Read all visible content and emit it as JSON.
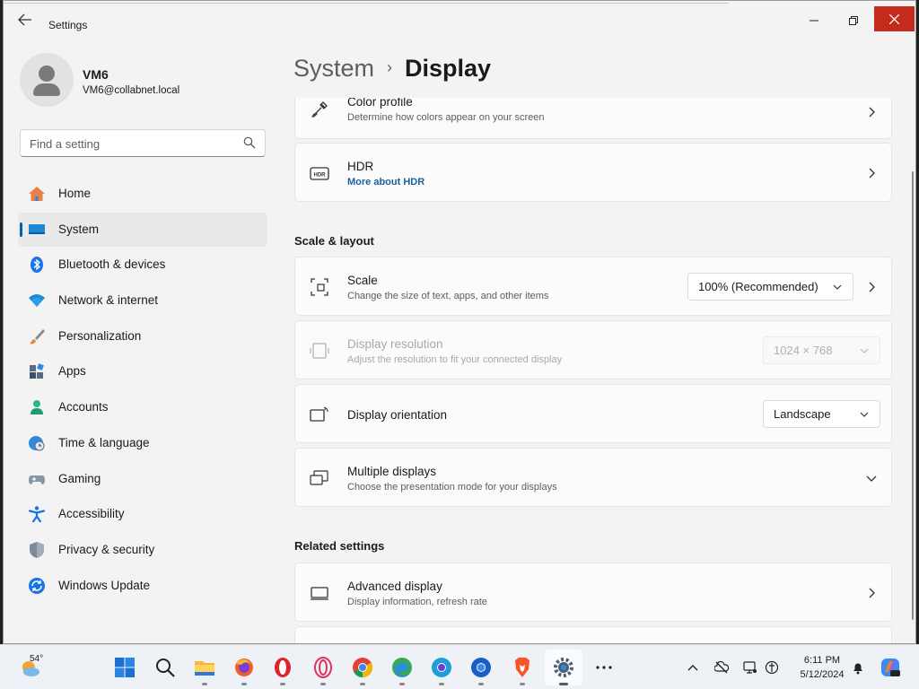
{
  "window": {
    "title": "Settings"
  },
  "user": {
    "name": "VM6",
    "email": "VM6@collabnet.local"
  },
  "search": {
    "placeholder": "Find a setting"
  },
  "nav": [
    {
      "label": "Home",
      "icon": "home-icon"
    },
    {
      "label": "System",
      "icon": "system-icon",
      "active": true
    },
    {
      "label": "Bluetooth & devices",
      "icon": "bluetooth-icon"
    },
    {
      "label": "Network & internet",
      "icon": "wifi-icon"
    },
    {
      "label": "Personalization",
      "icon": "brush-icon"
    },
    {
      "label": "Apps",
      "icon": "apps-icon"
    },
    {
      "label": "Accounts",
      "icon": "accounts-icon"
    },
    {
      "label": "Time & language",
      "icon": "globe-clock-icon"
    },
    {
      "label": "Gaming",
      "icon": "gamepad-icon"
    },
    {
      "label": "Accessibility",
      "icon": "accessibility-icon"
    },
    {
      "label": "Privacy & security",
      "icon": "shield-icon"
    },
    {
      "label": "Windows Update",
      "icon": "update-icon"
    }
  ],
  "breadcrumb": {
    "parent": "System",
    "separator": "›",
    "current": "Display"
  },
  "cards": {
    "color_profile": {
      "title": "Color profile",
      "subtitle": "Determine how colors appear on your screen"
    },
    "hdr": {
      "title": "HDR",
      "link": "More about HDR"
    },
    "scale": {
      "title": "Scale",
      "subtitle": "Change the size of text, apps, and other items",
      "value": "100% (Recommended)"
    },
    "resolution": {
      "title": "Display resolution",
      "subtitle": "Adjust the resolution to fit your connected display",
      "value": "1024 × 768",
      "disabled": true
    },
    "orientation": {
      "title": "Display orientation",
      "value": "Landscape"
    },
    "multiple": {
      "title": "Multiple displays",
      "subtitle": "Choose the presentation mode for your displays"
    },
    "advanced": {
      "title": "Advanced display",
      "subtitle": "Display information, refresh rate"
    }
  },
  "sections": {
    "scale_layout": "Scale & layout",
    "related": "Related settings"
  },
  "taskbar": {
    "weather": "54°",
    "apps": [
      "start-icon",
      "search-icon",
      "file-explorer-icon",
      "firefox-icon",
      "opera-icon",
      "opera-gx-icon",
      "chrome-icon",
      "edge-icon",
      "chromium-icon",
      "chrome-dev-icon",
      "brave-icon",
      "settings-icon",
      "more-icon"
    ],
    "time": "6:11 PM",
    "date": "5/12/2024"
  },
  "colors": {
    "accent": "#005fb8",
    "close": "#c42b1c",
    "link": "#1c5f9e"
  }
}
